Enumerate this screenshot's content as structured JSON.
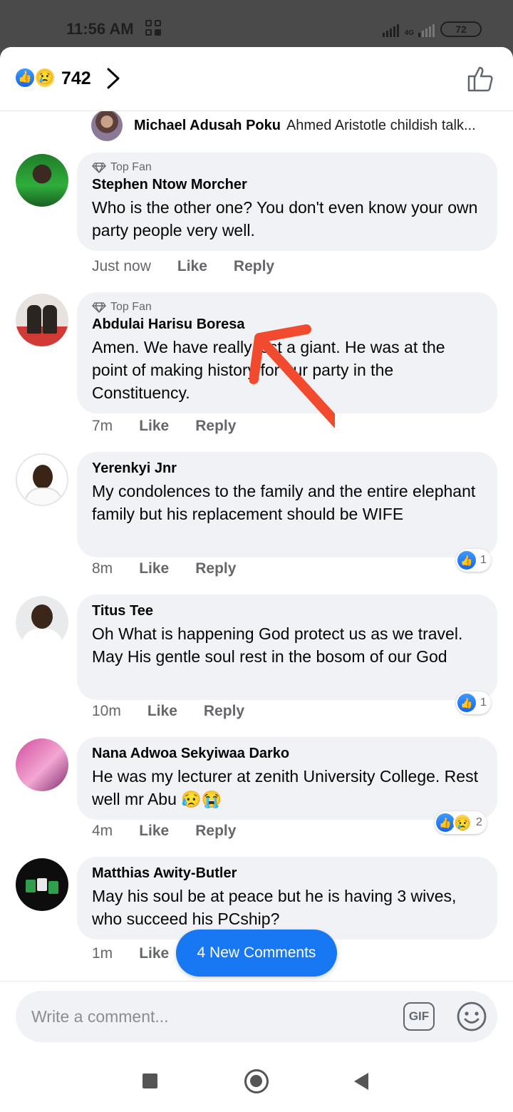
{
  "status": {
    "time": "11:56 AM",
    "network": "4G",
    "battery": "72"
  },
  "header": {
    "reaction_count": "742"
  },
  "reply_preview": {
    "author": "Michael Adusah Poku",
    "text": "Ahmed Aristotle childish talk..."
  },
  "comments": [
    {
      "badge": "Top Fan",
      "author": "Stephen Ntow Morcher",
      "text": "Who is the other one? You don't even know your own party people very well.",
      "time": "Just now",
      "like": "Like",
      "reply": "Reply"
    },
    {
      "badge": "Top Fan",
      "author": "Abdulai Harisu Boresa",
      "text": "Amen. We have really lost a giant. He was at the point of making history for our party in the Constituency.",
      "time": "7m",
      "like": "Like",
      "reply": "Reply"
    },
    {
      "author": "Yerenkyi Jnr",
      "text": "My condolences to the family and the entire elephant family but his replacement should be WIFE",
      "time": "8m",
      "like": "Like",
      "reply": "Reply",
      "reactions": "1"
    },
    {
      "author": "Titus Tee",
      "text": "Oh What is happening God protect us as we travel. May His gentle soul rest in the bosom of our God",
      "time": "10m",
      "like": "Like",
      "reply": "Reply",
      "reactions": "1"
    },
    {
      "author": "Nana Adwoa Sekyiwaa Darko",
      "text": "He was my lecturer at zenith University College. Rest well mr Abu 😥😭",
      "time": "4m",
      "like": "Like",
      "reply": "Reply",
      "reactions": "2"
    },
    {
      "author": "Matthias Awity-Butler",
      "text": "May his soul be at peace but he is having 3 wives, who succeed his PCship?",
      "time": "1m",
      "like": "Like"
    }
  ],
  "new_comments_button": "4 New Comments",
  "composer": {
    "placeholder": "Write a comment...",
    "gif_label": "GIF"
  },
  "colors": {
    "accent": "#1877f2",
    "bubble": "#f0f2f5",
    "annotation_arrow": "#f24a2e"
  }
}
